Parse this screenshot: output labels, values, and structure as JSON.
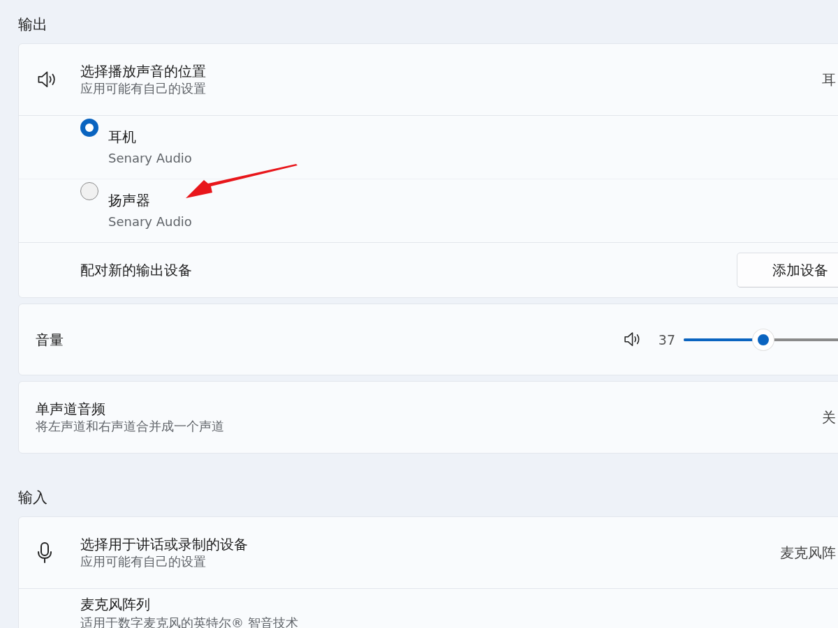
{
  "sections": [
    {
      "title": "输出",
      "cards": [
        {
          "rows": [
            {
              "kind": "header",
              "title": "选择播放声音的位置",
              "subtitle": "应用可能有自己的设置",
              "value": "耳"
            },
            {
              "kind": "radio",
              "title": "耳机",
              "subtitle": "Senary Audio",
              "selected": true
            },
            {
              "kind": "radio",
              "title": "扬声器",
              "subtitle": "Senary Audio",
              "selected": false
            },
            {
              "kind": "action",
              "title": "配对新的输出设备",
              "button": "添加设备"
            }
          ]
        },
        {
          "rows": [
            {
              "kind": "slider",
              "title": "音量",
              "reading": "37",
              "level": 0.37
            }
          ]
        },
        {
          "rows": [
            {
              "kind": "option",
              "title": "单声道音频",
              "subtitle": "将左声道和右声道合并成一个声道",
              "value": "关"
            }
          ]
        }
      ]
    },
    {
      "title": "输入",
      "cards": [
        {
          "rows": [
            {
              "kind": "header",
              "title": "选择用于讲话或录制的设备",
              "subtitle": "应用可能有自己的设置",
              "value": "麦克风阵"
            },
            {
              "kind": "device",
              "title": "麦克风阵列",
              "subtitle": "适用于数字麦克风的英特尔® 智音技术"
            }
          ]
        }
      ]
    }
  ]
}
